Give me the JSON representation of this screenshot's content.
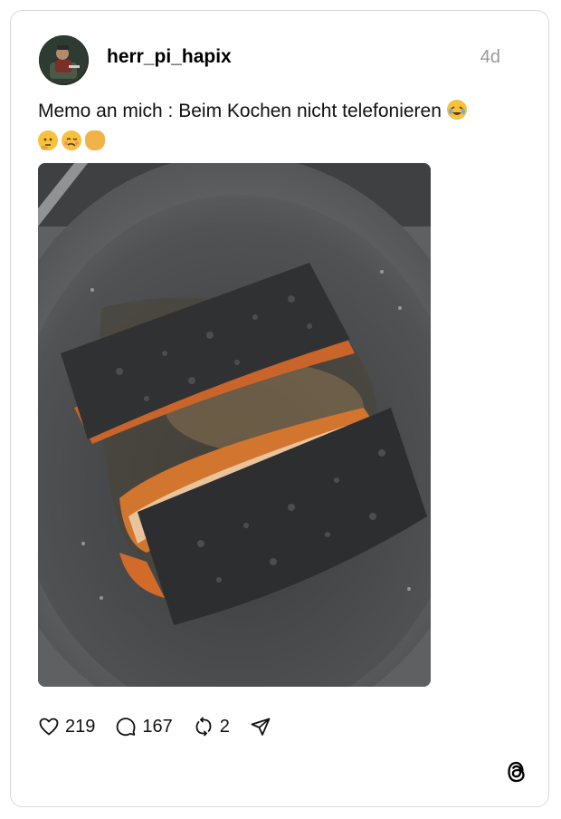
{
  "post": {
    "username": "herr_pi_hapix",
    "time": "4d",
    "text_line1": "Memo an mich : Beim Kochen nicht telefonieren",
    "emojis_line1": [
      "face-with-tears-of-joy-emoji"
    ],
    "emojis_line2": [
      "thinking-face-emoji",
      "woozy-face-emoji",
      "clapping-hands-emoji"
    ]
  },
  "actions": {
    "likes": "219",
    "replies": "167",
    "reposts": "2"
  },
  "icons": [
    "heart-icon",
    "reply-icon",
    "repost-icon",
    "share-icon",
    "threads-logo-icon"
  ],
  "colors": {
    "text": "#111111",
    "muted": "#999999",
    "border": "#d9d9d9"
  }
}
